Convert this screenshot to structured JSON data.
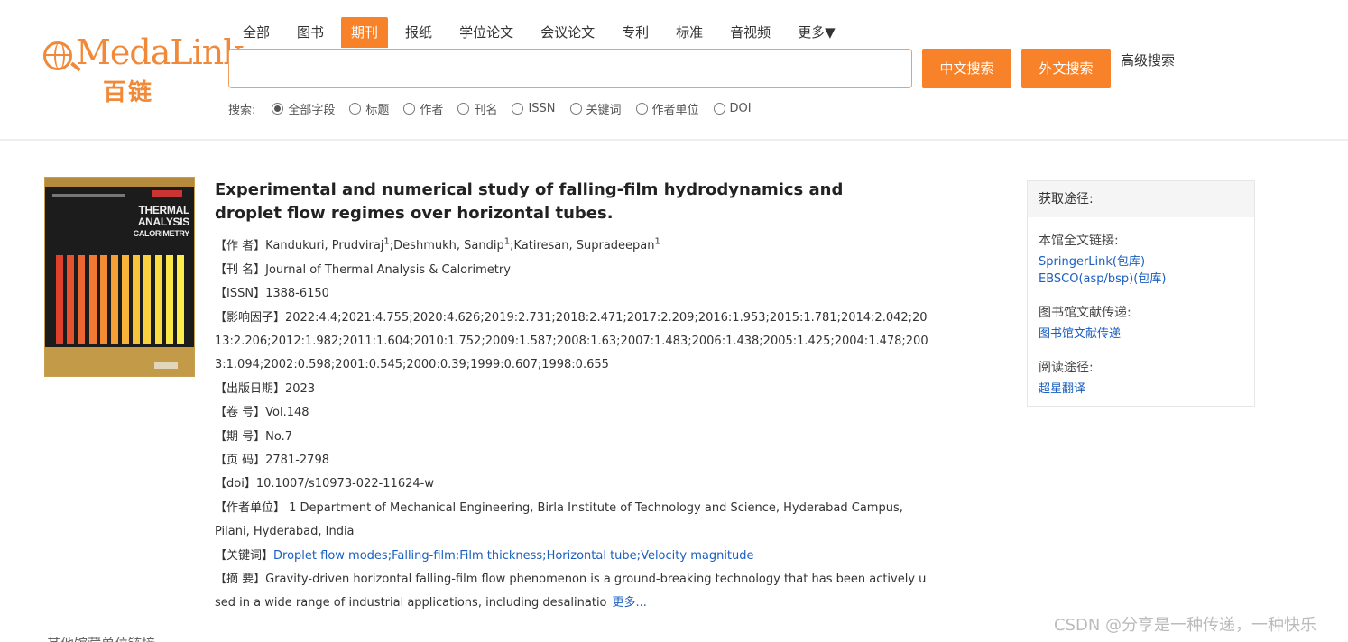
{
  "logo": {
    "text": "MedaLink",
    "cn": "百链"
  },
  "tabs": [
    "全部",
    "图书",
    "期刊",
    "报纸",
    "学位论文",
    "会议论文",
    "专利",
    "标准",
    "音视频",
    "更多▼"
  ],
  "active_tab_index": 2,
  "search": {
    "value": "",
    "cn_button": "中文搜索",
    "foreign_button": "外文搜索",
    "advanced": "高级搜索"
  },
  "search_fields": {
    "label": "搜索:",
    "options": [
      "全部字段",
      "标题",
      "作者",
      "刊名",
      "ISSN",
      "关键词",
      "作者单位",
      "DOI"
    ],
    "selected_index": 0
  },
  "cover": {
    "title_line1": "THERMAL",
    "title_line2": "ANALYSIS",
    "title_line3": "CALORIMETRY"
  },
  "article": {
    "title": "Experimental and numerical study of falling-film hydrodynamics and droplet flow regimes over horizontal tubes.",
    "authors_label": "【作 者】",
    "authors": [
      {
        "name": "Kandukuri, Prudviraj",
        "sup": "1"
      },
      {
        "name": "Deshmukh, Sandip",
        "sup": "1"
      },
      {
        "name": "Katiresan, Supradeepan",
        "sup": "1"
      }
    ],
    "journal_label": "【刊 名】",
    "journal": "Journal of Thermal Analysis & Calorimetry",
    "issn_label": "【ISSN】",
    "issn": "1388-6150",
    "if_label": "【影响因子】",
    "impact_factor": "2022:4.4;2021:4.755;2020:4.626;2019:2.731;2018:2.471;2017:2.209;2016:1.953;2015:1.781;2014:2.042;2013:2.206;2012:1.982;2011:1.604;2010:1.752;2009:1.587;2008:1.63;2007:1.483;2006:1.438;2005:1.425;2004:1.478;2003:1.094;2002:0.598;2001:0.545;2000:0.39;1999:0.607;1998:0.655",
    "date_label": "【出版日期】",
    "date": "2023",
    "vol_label": "【卷 号】",
    "volume": "Vol.148",
    "no_label": "【期 号】",
    "issue": "No.7",
    "pages_label": "【页 码】",
    "pages": "2781-2798",
    "doi_label": "【doi】",
    "doi": "10.1007/s10973-022-11624-w",
    "affil_label": "【作者单位】",
    "affiliation": " 1 Department of Mechanical Engineering, Birla Institute of Technology and Science, Hyderabad Campus, Pilani, Hyderabad, India",
    "kw_label": "【关键词】",
    "keywords": [
      "Droplet flow modes",
      "Falling-film",
      "Film thickness",
      "Horizontal tube",
      "Velocity magnitude"
    ],
    "abstract_label": "【摘 要】",
    "abstract": "Gravity-driven horizontal falling-film flow phenomenon is a ground-breaking technology that has been actively used in a wide range of industrial applications, including desalinatio",
    "more": "更多..."
  },
  "sidebar": {
    "heading": "获取途径:",
    "fulltext_label": "本馆全文链接:",
    "fulltext_links": [
      "SpringerLink(包库)",
      "EBSCO(asp/bsp)(包库)"
    ],
    "delivery_label": "图书馆文献传递:",
    "delivery_link": "图书馆文献传递",
    "read_label": "阅读途径:",
    "read_link": "超星翻译"
  },
  "footer_cut": "其他馆藏单位链接",
  "watermark": "CSDN @分享是一种传递，一种快乐"
}
